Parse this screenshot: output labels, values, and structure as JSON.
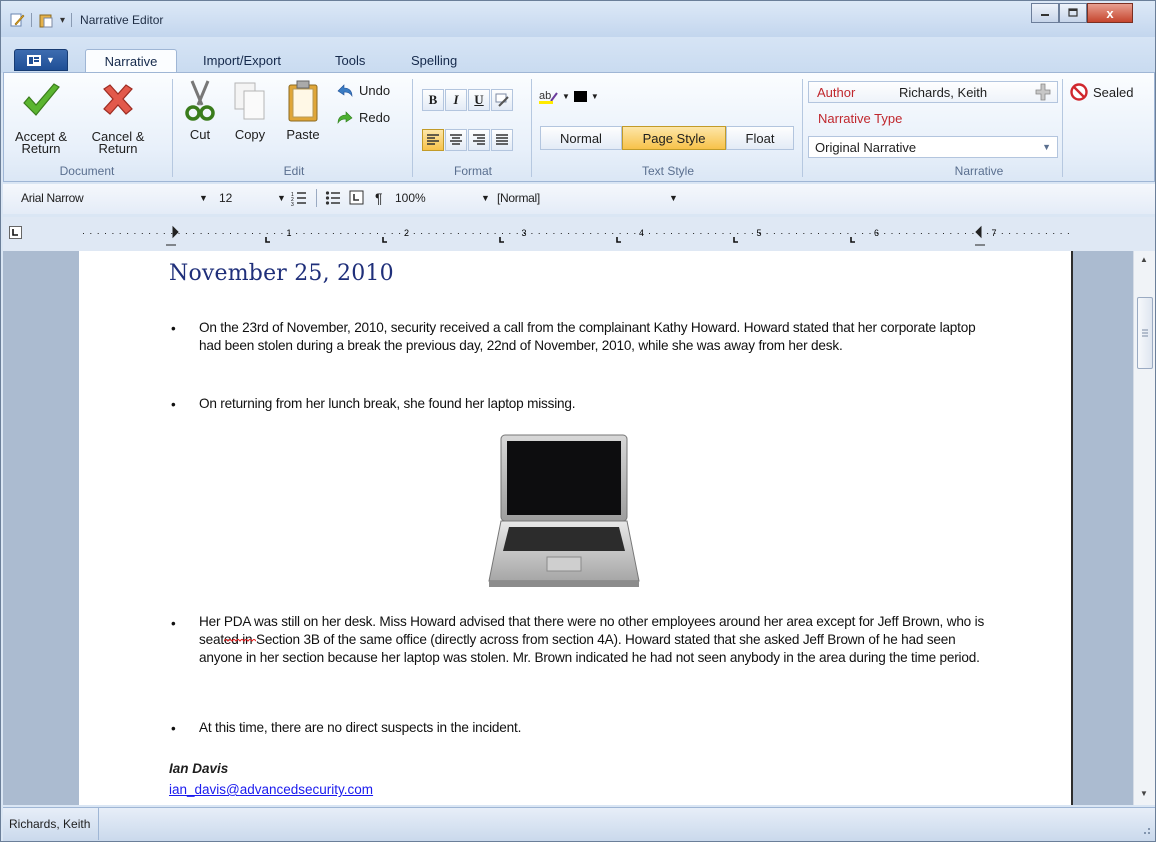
{
  "window": {
    "title": "Narrative Editor",
    "close_label": "x"
  },
  "tabs": [
    "Narrative",
    "Import/Export",
    "Tools",
    "Spelling"
  ],
  "document_group": {
    "accept": "Accept &\nReturn",
    "cancel": "Cancel &\nReturn",
    "label": "Document"
  },
  "edit_group": {
    "cut": "Cut",
    "copy": "Copy",
    "paste": "Paste",
    "undo": "Undo",
    "redo": "Redo",
    "label": "Edit"
  },
  "format_group": {
    "bold": "B",
    "italic": "I",
    "underline": "U",
    "label": "Format"
  },
  "text_style_group": {
    "styles": [
      "Normal",
      "Page Style",
      "Float"
    ],
    "selected": "Page Style",
    "label": "Text Style"
  },
  "narrative_group": {
    "author_label": "Author",
    "author_value": "Richards, Keith",
    "type_label": "Narrative Type",
    "type_value": "Original Narrative",
    "sealed_label": "Sealed",
    "label": "Narrative"
  },
  "format_toolbar": {
    "font": "Arial Narrow",
    "size": "12",
    "zoom": "100%",
    "style": "[Normal]",
    "pilcrow": "¶"
  },
  "ruler": {
    "numbers": [
      "1",
      "2",
      "3",
      "4",
      "5",
      "6",
      "7"
    ]
  },
  "document": {
    "date": "November 25, 2010",
    "bullets": [
      "On the 23rd of November, 2010, security received a call from the complainant Kathy Howard. Howard stated that her corporate laptop had been stolen during a break the previous day, 22nd of November, 2010, while she was away from her desk.",
      "On returning from her lunch break, she found her laptop missing.",
      "Her PDA was still on her desk. Miss Howard advised that there were no other employees around her area except for Jeff Brown, who is seated in Section 3B of the same office (directly across from section 4A). Howard stated that she asked Jeff Brown of he had seen anyone in her section because her laptop was stolen. Mr. Brown indicated he had not seen anybody in the area during the time period.",
      "At this time, there are no direct suspects in the incident."
    ],
    "bullet_char": "•",
    "signature_name": "Ian Davis",
    "signature_email": "ian_davis@advancedsecurity.com",
    "image": "laptop-photo"
  },
  "status": {
    "user": "Richards, Keith"
  },
  "colors": {
    "accent": "#1f4f96",
    "selected": "#f7c24a",
    "date_text": "#1f2f7a",
    "field_label": "#c0272d"
  }
}
